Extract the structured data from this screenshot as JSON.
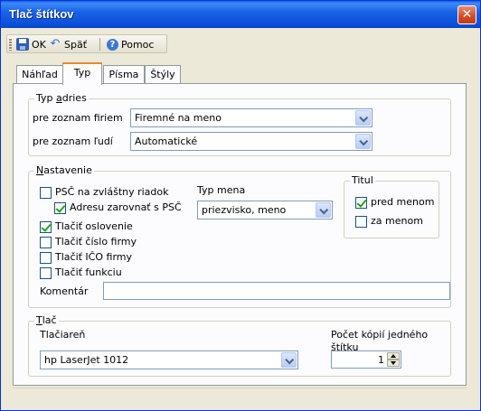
{
  "window": {
    "title": "Tlač štítkov",
    "close_glyph": "✕"
  },
  "toolbar": {
    "ok_label": "OK",
    "back_label": "Späť",
    "help_label": "Pomoc",
    "icons": [
      "save-icon",
      "undo-icon",
      "help-icon"
    ]
  },
  "tabs": [
    {
      "label": "Náhľad",
      "active": false
    },
    {
      "label": "Typ",
      "active": true
    },
    {
      "label": "Písma",
      "active": false
    },
    {
      "label": "Štýly",
      "active": false
    }
  ],
  "address_type": {
    "legend_prefix": "Typ ",
    "legend_underlined": "a",
    "legend_suffix": "dries",
    "companies_label": "pre zoznam firiem",
    "companies_value": "Firemné na meno",
    "people_label": "pre zoznam ľudí",
    "people_value": "Automatické"
  },
  "settings": {
    "legend_underlined": "N",
    "legend_suffix": "astavenie",
    "psc_separate": {
      "label": "PSČ na zvláštny riadok",
      "checked": false
    },
    "align_address": {
      "label": "Adresu zarovnať s PSČ",
      "checked": true
    },
    "print_salutation": {
      "label": "Tlačiť oslovenie",
      "checked": true
    },
    "print_company_no": {
      "label": "Tlačiť číslo firmy",
      "checked": false
    },
    "print_ico": {
      "label": "Tlačiť IČO firmy",
      "checked": false
    },
    "print_function": {
      "label": "Tlačiť funkciu",
      "checked": false
    },
    "name_type_label": "Typ mena",
    "name_type_value": "priezvisko, meno",
    "title_group": {
      "legend": "Titul",
      "before": {
        "label": "pred menom",
        "checked": true
      },
      "after": {
        "label": "za menom",
        "checked": false
      }
    },
    "comment_label": "Komentár",
    "comment_value": ""
  },
  "print": {
    "legend_underlined": "T",
    "legend_suffix": "lač",
    "printer_label": "Tlačiareň",
    "printer_value": "hp LaserJet 1012",
    "copies_label": "Počet kópií jedného štítku",
    "copies_value": "1"
  },
  "colors": {
    "title_bar": "#0b4fd8",
    "tab_highlight": "#e68b2c",
    "check_mark": "#21a121",
    "close_button": "#d34a25"
  }
}
